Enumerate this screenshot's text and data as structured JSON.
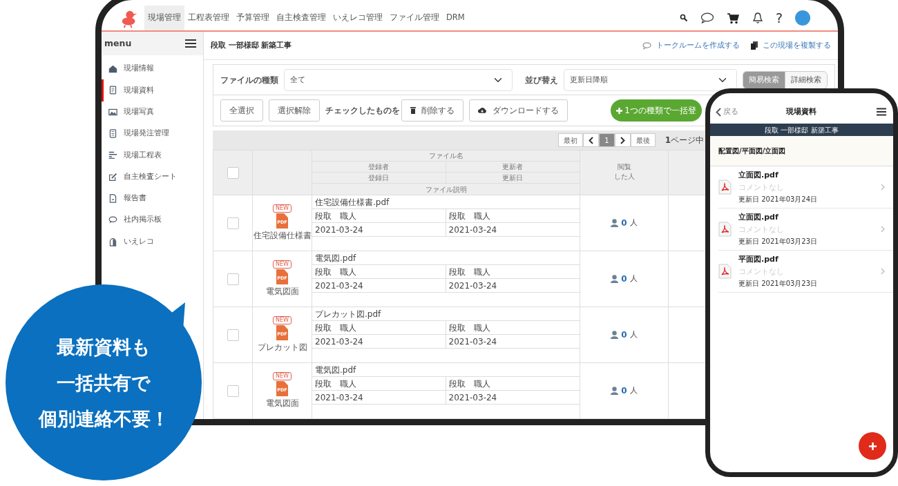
{
  "tablet": {
    "nav": {
      "items": [
        {
          "label": "現場管理",
          "selected": true
        },
        {
          "label": "工程表管理",
          "selected": false
        },
        {
          "label": "予算管理",
          "selected": false
        },
        {
          "label": "自主検査管理",
          "selected": false
        },
        {
          "label": "いえレコ管理",
          "selected": false
        },
        {
          "label": "ファイル管理",
          "selected": false
        },
        {
          "label": "DRM",
          "selected": false
        }
      ],
      "help": "?"
    },
    "sidebar": {
      "title": "menu",
      "items": [
        {
          "label": "現場情報",
          "kind": "house",
          "selected": false
        },
        {
          "label": "現場資料",
          "kind": "document",
          "selected": true
        },
        {
          "label": "現場写真",
          "kind": "photo",
          "selected": false
        },
        {
          "label": "現場発注管理",
          "kind": "calculator",
          "selected": false
        },
        {
          "label": "現場工程表",
          "kind": "gantt",
          "selected": false
        },
        {
          "label": "自主検査シート",
          "kind": "edit",
          "selected": false
        },
        {
          "label": "報告書",
          "kind": "report",
          "selected": false
        },
        {
          "label": "社内掲示板",
          "kind": "chat",
          "selected": false
        },
        {
          "label": "いえレコ",
          "kind": "arch",
          "selected": false
        }
      ]
    },
    "page": {
      "title": "段取 一部様邸 新築工事",
      "links": [
        {
          "label": "トークルームを作成する",
          "kind": "chat"
        },
        {
          "label": "この現場を複製する",
          "kind": "copy"
        }
      ]
    },
    "filters": {
      "type_label": "ファイルの種類",
      "type_value": "全て",
      "sort_label": "並び替え",
      "sort_value": "更新日降順",
      "modes": [
        {
          "label": "簡易検索",
          "selected": true
        },
        {
          "label": "詳細検索",
          "selected": false
        }
      ]
    },
    "actions": {
      "select_all": "全選択",
      "deselect": "選択解除",
      "checked_label": "チェックしたものを",
      "delete": "削除する",
      "download": "ダウンロードする",
      "bulk": "1つの種類で一括登"
    },
    "pagination": {
      "first": "最初",
      "pages": [
        {
          "label": "1",
          "selected": true
        }
      ],
      "last": "最後",
      "summary": "**1**ページ中"
    },
    "table": {
      "header": {
        "checked": false,
        "file_name": "ファイル名",
        "registrant": "登録者",
        "updater": "更新者",
        "registered": "登録日",
        "updated": "更新日",
        "description": "ファイル説明",
        "viewers": [
          "閲覧",
          "した人"
        ]
      },
      "rows": [
        {
          "checked": false,
          "badge": "NEW",
          "file_icon": "PDF",
          "type": "住宅設備仕様書",
          "file": "住宅設備仕様書.pdf",
          "registrant": "段取　職人",
          "updater": "段取　職人",
          "registered": "2021-03-24",
          "updated": "2021-03-24",
          "views": "0",
          "views_unit": "人"
        },
        {
          "checked": false,
          "badge": "NEW",
          "file_icon": "PDF",
          "type": "電気図面",
          "file": "電気図.pdf",
          "registrant": "段取　職人",
          "updater": "段取　職人",
          "registered": "2021-03-24",
          "updated": "2021-03-24",
          "views": "0",
          "views_unit": "人"
        },
        {
          "checked": false,
          "badge": "NEW",
          "file_icon": "PDF",
          "type": "プレカット図",
          "file": "プレカット図.pdf",
          "registrant": "段取　職人",
          "updater": "段取　職人",
          "registered": "2021-03-24",
          "updated": "2021-03-24",
          "views": "0",
          "views_unit": "人"
        },
        {
          "checked": false,
          "badge": "NEW",
          "file_icon": "PDF",
          "type": "電気図面",
          "file": "電気図.pdf",
          "registrant": "段取　職人",
          "updater": "段取　職人",
          "registered": "2021-03-24",
          "updated": "2021-03-24",
          "views": "0",
          "views_unit": "人"
        }
      ]
    }
  },
  "phone": {
    "back": "戻る",
    "title": "現場資料",
    "project": "段取 一部様邸 新築工事",
    "category": "配置図/平面図/立面図",
    "files": [
      {
        "name": "立面図.pdf",
        "comment": "コメントなし",
        "updated": "更新日 2021年03月24日"
      },
      {
        "name": "立面図.pdf",
        "comment": "コメントなし",
        "updated": "更新日 2021年03月23日"
      },
      {
        "name": "平面図.pdf",
        "comment": "コメントなし",
        "updated": "更新日 2021年03月23日"
      }
    ]
  },
  "bubble": {
    "lines": [
      "最新資料も",
      "一括共有で",
      "個別連絡不要！"
    ]
  }
}
